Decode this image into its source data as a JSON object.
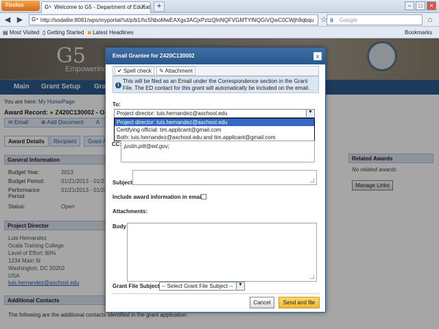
{
  "browser": {
    "app_button": "Firefox",
    "tab_title": "Welcome to G5 - Department of Educati...",
    "new_tab": "+",
    "url": "http://sodalite:8081/wps/myportal/!ut/p/b1/hc5NboMwEAXgs3ACjxPztzQlnNQFVGMTYlNQGiVQwC0CWjh9qbqu",
    "search_placeholder": "Google",
    "bookmarks": [
      "Most Visited",
      "Getting Started",
      "Latest Headlines"
    ],
    "bookmarks_menu": "Bookmarks"
  },
  "page": {
    "logo": "G5",
    "tagline": "Empowering",
    "nav": [
      "Main",
      "Grant Setup",
      "Gra"
    ],
    "breadcrumb_prefix": "You are here:",
    "breadcrumb_link": "My HomePage",
    "award_record": "Award Record:",
    "award_number": "Z420C130002 - Oca",
    "actions": [
      "Email",
      "Add Document",
      "A"
    ],
    "tabs": [
      "Award Details",
      "Recipient",
      "Grant A"
    ],
    "general_info": {
      "heading": "General Information",
      "fields": [
        {
          "label": "Budget Year:",
          "value": "2013"
        },
        {
          "label": "Budget Period:",
          "value": "01/21/2013 - 01/2"
        },
        {
          "label": "Performance Period:",
          "value": "01/21/2013 - 01/23"
        },
        {
          "label": "Status:",
          "value": "Open"
        }
      ]
    },
    "project_director": {
      "heading": "Project Director",
      "lines": [
        "Luis Hernandez",
        "Ocala Training College",
        "Level of Effort: 80%",
        "1234 Main St",
        "Washington, DC 20202",
        "USA"
      ],
      "email": "luis.hernandez@aschool.edu"
    },
    "additional_contacts": {
      "heading": "Additional Contacts",
      "text": "The following are the additional contacts identified in the grant application."
    },
    "related_awards": {
      "heading": "Related Awards",
      "empty": "No related awards",
      "button": "Manage Links"
    }
  },
  "dialog": {
    "title": "Email Grantee for Z420C130002",
    "close": "x",
    "toolbar": [
      "Spell check",
      "Attachment"
    ],
    "info": "This will be filed as an Email under the Correspondence section in the Grant File. The ED contact for this grant will automatically be included on the email.",
    "to_label": "To:",
    "to_value": "Project director: luis.hernandez@aschool.edu",
    "options": [
      "Project director: luis.hernandez@aschool.edu",
      "Certifying official: tim.applicant@gmail.com",
      "Both: luis.hernandez@aschool.edu and tim.applicant@gmail.com"
    ],
    "cc_label": "CC:",
    "cc_value": "justin.pitt@ed.gov;",
    "subject_label": "Subject:",
    "include_label": "Include award information in email:",
    "include_checked": false,
    "attachments_label": "Attachments:",
    "body_label": "Body:",
    "gf_label": "Grant File Subject:",
    "required_mark": "*",
    "gf_value": "-- Select Grant File Subject --",
    "cancel": "Cancel",
    "send": "Send and file"
  }
}
